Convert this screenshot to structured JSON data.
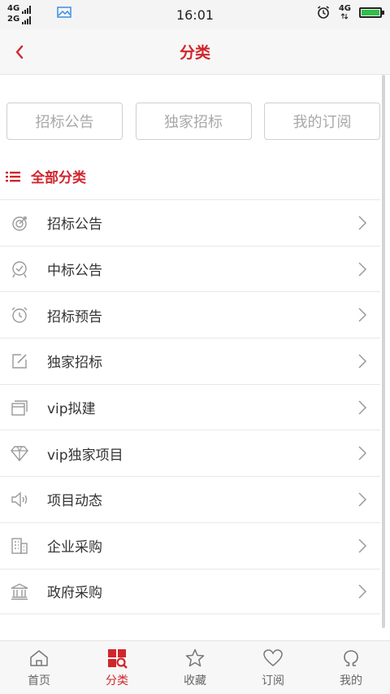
{
  "status_bar": {
    "net1": "4G",
    "net2": "2G",
    "time": "16:01",
    "net_right": "4G"
  },
  "header": {
    "title": "分类"
  },
  "tabs": [
    {
      "label": "招标公告"
    },
    {
      "label": "独家招标"
    },
    {
      "label": "我的订阅"
    }
  ],
  "section": {
    "label": "全部分类"
  },
  "list": [
    {
      "label": "招标公告",
      "icon": "target-icon"
    },
    {
      "label": "中标公告",
      "icon": "badge-check-icon"
    },
    {
      "label": "招标预告",
      "icon": "alarm-clock-icon"
    },
    {
      "label": "独家招标",
      "icon": "edit-icon"
    },
    {
      "label": "vip拟建",
      "icon": "stack-window-icon"
    },
    {
      "label": "vip独家项目",
      "icon": "diamond-icon"
    },
    {
      "label": "项目动态",
      "icon": "speaker-icon"
    },
    {
      "label": "企业采购",
      "icon": "building-icon"
    },
    {
      "label": "政府采购",
      "icon": "government-icon"
    }
  ],
  "bottom_nav": [
    {
      "label": "首页",
      "icon": "home-icon",
      "active": false
    },
    {
      "label": "分类",
      "icon": "category-icon",
      "active": true
    },
    {
      "label": "收藏",
      "icon": "star-icon",
      "active": false
    },
    {
      "label": "订阅",
      "icon": "heart-icon",
      "active": false
    },
    {
      "label": "我的",
      "icon": "profile-icon",
      "active": false
    }
  ],
  "colors": {
    "accent": "#d0262c",
    "text": "#333333",
    "muted": "#a8a8a8",
    "icon": "#9a9a9a"
  }
}
